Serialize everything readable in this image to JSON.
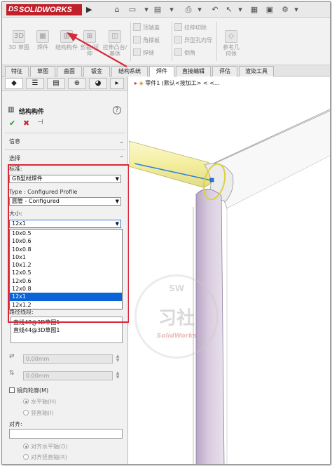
{
  "app": {
    "logo_prefix": "DS",
    "logo_text": "SOLIDWORKS"
  },
  "ribbon": {
    "items": [
      {
        "label": "3D 草图"
      },
      {
        "label": "焊件"
      },
      {
        "label": "结构构件"
      },
      {
        "label": "剪裁/延伸"
      },
      {
        "label": "拉伸凸台/基体"
      },
      {
        "label": "顶端盖"
      },
      {
        "label": "角撑板"
      },
      {
        "label": "焊缝"
      },
      {
        "label": "拉伸切除"
      },
      {
        "label": "异型孔向导"
      },
      {
        "label": "倒角"
      },
      {
        "label": "参考几何体"
      }
    ]
  },
  "tabs": [
    {
      "label": "特征"
    },
    {
      "label": "草图"
    },
    {
      "label": "曲面"
    },
    {
      "label": "钣金"
    },
    {
      "label": "结构系统"
    },
    {
      "label": "焊件"
    },
    {
      "label": "直接编辑"
    },
    {
      "label": "评估"
    },
    {
      "label": "渲染工具"
    }
  ],
  "panel": {
    "title": "结构构件",
    "help": "?",
    "ok": "✔",
    "cancel": "✖",
    "pin": "⊣",
    "info_section": "信息",
    "select_section": "选择",
    "standard_label": "标准:",
    "standard_value": "GB型材焊件",
    "type_label": "Type : Configured Profile",
    "type_value": "圆管 - Configured",
    "size_label": "大小:",
    "size_value": "12x1",
    "size_options": [
      "10x0.5",
      "10x0.6",
      "10x0.8",
      "10x1",
      "10x1.2",
      "12x0.5",
      "12x0.6",
      "12x0.8",
      "12x1",
      "12x1.2"
    ],
    "size_selected_index": 8,
    "path_label": "路径线段:",
    "path_items": [
      "直线48@3D草图1",
      "直线44@3D草图1"
    ],
    "offset1": "0.00mm",
    "offset2": "0.00mm",
    "mirror_label": "镜向轮廓(M)",
    "horizontal_axis": "水平轴(H)",
    "vertical_axis": "竖直轴(I)",
    "align_label": "对齐:",
    "align_horizontal": "对齐水平轴(O)",
    "align_vertical": "对齐竖直轴(R)"
  },
  "viewport": {
    "tree_text": "零件1 (默认<按加工> < <...",
    "watermark_main": "习社",
    "watermark_sub": "SolidWorks",
    "watermark_top": "SW"
  },
  "colors": {
    "accent_red": "#d9283a",
    "selected_blue": "#0a64d8",
    "highlight_yellow": "#f6f2a8",
    "tube_purple": "#c9b6d6"
  }
}
